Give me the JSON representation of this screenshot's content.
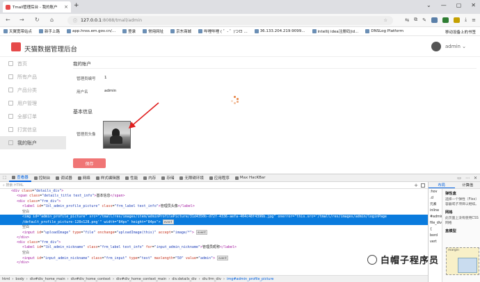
{
  "browser": {
    "tab_title": "Tmall管理后台 - 我的账户",
    "new_tab": "+",
    "url_host": "127.0.0.1",
    "url_path": ":8088/tmall/admin",
    "bookmarks": [
      "天翼宽带站点",
      "新手上路",
      "app.hnss.em.gov.cn/...",
      "登录",
      "常用网址",
      "京东商城",
      "哔哩哔哩 ( ゜- ゜)つロ ...",
      "36.133.204.219:9099...",
      "intellij idea注册码|id...",
      "DNSLog Platform"
    ],
    "bookmarks_right": "移动设备上的书签"
  },
  "app": {
    "brand": "天猫数据管理后台",
    "user": "admin",
    "brand_color": "#e64a4a",
    "sidebar": [
      {
        "label": "首页",
        "active": false
      },
      {
        "label": "所有产品",
        "active": false
      },
      {
        "label": "产品分类",
        "active": false
      },
      {
        "label": "用户管理",
        "active": false
      },
      {
        "label": "全部订单",
        "active": false
      },
      {
        "label": "打赏信息",
        "active": false
      },
      {
        "label": "我的账户",
        "active": true
      }
    ],
    "breadcrumb": "我的账户",
    "fields": [
      {
        "label": "管理员编号",
        "value": "1"
      },
      {
        "label": "用户名",
        "value": "admin"
      }
    ],
    "section_title": "基本信息",
    "picture_label": "管理员头像",
    "save_label": "保存",
    "save_color": "#f07575"
  },
  "devtools": {
    "tabs": [
      "查看器",
      "控制台",
      "调试器",
      "网络",
      "样式编辑器",
      "性能",
      "内存",
      "存储",
      "无障碍环境",
      "应用程序",
      "Max HacKBar"
    ],
    "search_placeholder": "搜索 HTML",
    "tree": [
      {
        "indent": 4,
        "html": "<span class='tg'>&lt;div</span> <span class='at'>class</span>=<span class='vl'>\"details_div\"</span><span class='tg'>&gt;</span>",
        "sel": false
      },
      {
        "indent": 6,
        "html": "<span class='tg'>&lt;span</span> <span class='at'>class</span>=<span class='vl'>\"details_title text_info\"</span><span class='tg'>&gt;</span>基本信息<span class='tg'>&lt;/span&gt;</span>",
        "sel": false
      },
      {
        "indent": 6,
        "html": "<span class='tg'>&lt;div</span> <span class='at'>class</span>=<span class='vl'>\"frm_div\"</span><span class='tg'>&gt;</span>",
        "sel": false
      },
      {
        "indent": 8,
        "html": "<span class='tg'>&lt;label</span> <span class='at'>id</span>=<span class='vl'>\"lbl_admin_profile_picture\"</span> <span class='at'>class</span>=<span class='vl'>\"frm_label text_info\"</span><span class='tg'>&gt;</span>管理员头像<span class='tg'>&lt;/label&gt;</span>",
        "sel": false
      },
      {
        "indent": 8,
        "html": "<span class='plain'>空白</span>",
        "sel": false
      },
      {
        "indent": 8,
        "html": "<span class='tg'>&lt;img</span> <span class='at'>id</span>=<span class='vl'>\"admin_profile_picture\"</span> <span class='at'>src</span>=<span class='vl'>\"/tmall/res/images/item/adminProfilePicture/31d4350b-d72f-4336-aefa-404c48f4396b.jpg\"</span> <span class='at'>onerror</span>=<span class='vl'>\"this.src='/tmall/res/images/admin/loginPage</span>",
        "sel": true
      },
      {
        "indent": 8,
        "html": "<span class='vl'>/default_profile_picture-128x128.png'\"</span> <span class='at'>width</span>=<span class='vl'>\"84px\"</span> <span class='at'>height</span>=<span class='vl'>\"84px\"</span><span class='tg'>&gt;</span><span class='ev'>event</span>",
        "sel": true
      },
      {
        "indent": 8,
        "html": "<span class='plain'>空白</span>",
        "sel": false
      },
      {
        "indent": 8,
        "html": "<span class='tg'>&lt;input</span> <span class='at'>id</span>=<span class='vl'>\"uploadImage\"</span> <span class='at'>type</span>=<span class='vl'>\"file\"</span> <span class='at'>onchange</span>=<span class='vl'>\"uploadImage(this)\"</span> <span class='at'>accept</span>=<span class='vl'>\"image/*\"</span><span class='tg'>&gt;</span><span class='ev'>event</span>",
        "sel": false
      },
      {
        "indent": 6,
        "html": "<span class='tg'>&lt;/div&gt;</span>",
        "sel": false
      },
      {
        "indent": 6,
        "html": "<span class='tg'>&lt;div</span> <span class='at'>class</span>=<span class='vl'>\"frm_div\"</span><span class='tg'>&gt;</span>",
        "sel": false
      },
      {
        "indent": 8,
        "html": "<span class='tg'>&lt;label</span> <span class='at'>id</span>=<span class='vl'>\"lbl_admin_nickname\"</span> <span class='at'>class</span>=<span class='vl'>\"frm_label text_info\"</span> <span class='at'>for</span>=<span class='vl'>\"input_admin_nickname\"</span><span class='tg'>&gt;</span>管理员昵称<span class='tg'>&lt;/label&gt;</span>",
        "sel": false
      },
      {
        "indent": 8,
        "html": "<span class='plain'>空白</span>",
        "sel": false
      },
      {
        "indent": 8,
        "html": "<span class='tg'>&lt;input</span> <span class='at'>id</span>=<span class='vl'>\"input_admin_nickname\"</span> <span class='at'>class</span>=<span class='vl'>\"frm_input\"</span> <span class='at'>type</span>=<span class='vl'>\"text\"</span> <span class='at'>maxlength</span>=<span class='vl'>\"50\"</span> <span class='at'>value</span>=<span class='vl'>\"admin\"</span><span class='tg'>&gt;</span><span class='ev'>event</span>",
        "sel": false
      },
      {
        "indent": 6,
        "html": "<span class='tg'>&lt;/div&gt;</span>",
        "sel": false
      }
    ],
    "crumbs": [
      "html",
      "body",
      "div#div_home_main",
      "div#div_home_context",
      "div#div_home_context_main",
      "div.details_div",
      "div.frm_div"
    ],
    "crumb_last": "img#admin_profile_picture",
    "side_tabs": [
      "布局",
      "计算值"
    ],
    "rules": [
      ":hov",
      ".cl",
      "元素",
      "inline",
      "#admin",
      "file_div",
      "{",
      "bord",
      "vert"
    ],
    "layout_head": "弹性盒",
    "layout_text": "选择一个弹性（Flex）容器或子项目以继续。",
    "grid_head": "网格",
    "grid_text": "此页面上没有使用CSS网格",
    "box_head": "盒模型",
    "box_margin": "margin"
  },
  "watermark": "白帽子程序员"
}
